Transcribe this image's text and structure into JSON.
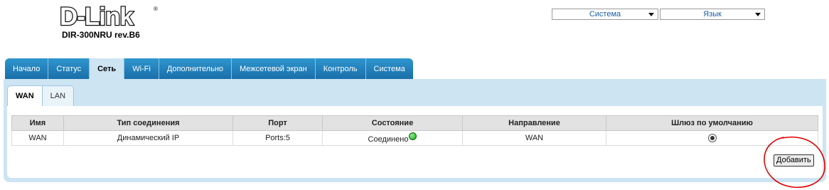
{
  "brand": {
    "logo": "D-Link",
    "registered": "®",
    "model": "DIR-300NRU rev.B6"
  },
  "top_selects": [
    {
      "label": "Система"
    },
    {
      "label": "Язык"
    }
  ],
  "main_tabs": [
    {
      "label": "Начало",
      "active": false
    },
    {
      "label": "Статус",
      "active": false
    },
    {
      "label": "Сеть",
      "active": true
    },
    {
      "label": "Wi-Fi",
      "active": false
    },
    {
      "label": "Дополнительно",
      "active": false
    },
    {
      "label": "Межсетевой экран",
      "active": false
    },
    {
      "label": "Контроль",
      "active": false
    },
    {
      "label": "Система",
      "active": false
    }
  ],
  "sub_tabs": [
    {
      "label": "WAN",
      "active": true
    },
    {
      "label": "LAN",
      "active": false
    }
  ],
  "table": {
    "headers": [
      "Имя",
      "Тип соединения",
      "Порт",
      "Состояние",
      "Направление",
      "Шлюз по умолчанию"
    ],
    "rows": [
      {
        "name": "WAN",
        "type": "Динамический IP",
        "port": "Ports:5",
        "state": "Соединено",
        "direction": "WAN",
        "default_gateway_selected": true
      }
    ]
  },
  "actions": {
    "add_label": "Добавить"
  },
  "colors": {
    "tab_blue": "#1f7fbf",
    "panel_bg": "#cde4f3",
    "status_green": "#16a216",
    "annotation_red": "#e00000"
  }
}
